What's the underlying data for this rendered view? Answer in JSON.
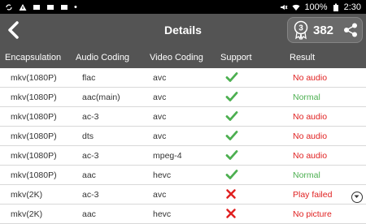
{
  "status_bar": {
    "battery": "100%",
    "time": "2:30"
  },
  "header": {
    "title": "Details",
    "score_badge_digit": "3",
    "score": "382"
  },
  "table": {
    "headers": [
      "Encapsulation",
      "Audio Coding",
      "Video Coding",
      "Support",
      "Result"
    ],
    "rows": [
      {
        "encapsulation": "mkv(1080P)",
        "audio": "flac",
        "video": "avc",
        "support": "check",
        "result": "No audio",
        "result_color": "#e02020"
      },
      {
        "encapsulation": "mkv(1080P)",
        "audio": "aac(main)",
        "video": "avc",
        "support": "check",
        "result": "Normal",
        "result_color": "#4caf50"
      },
      {
        "encapsulation": "mkv(1080P)",
        "audio": "ac-3",
        "video": "avc",
        "support": "check",
        "result": "No audio",
        "result_color": "#e02020"
      },
      {
        "encapsulation": "mkv(1080P)",
        "audio": "dts",
        "video": "avc",
        "support": "check",
        "result": "No audio",
        "result_color": "#e02020"
      },
      {
        "encapsulation": "mkv(1080P)",
        "audio": "ac-3",
        "video": "mpeg-4",
        "support": "check",
        "result": "No audio",
        "result_color": "#e02020"
      },
      {
        "encapsulation": "mkv(1080P)",
        "audio": "aac",
        "video": "hevc",
        "support": "check",
        "result": "Normal",
        "result_color": "#4caf50"
      },
      {
        "encapsulation": "mkv(2K)",
        "audio": "ac-3",
        "video": "avc",
        "support": "cross",
        "result": "Play failed",
        "result_color": "#e02020"
      },
      {
        "encapsulation": "mkv(2K)",
        "audio": "aac",
        "video": "hevc",
        "support": "cross",
        "result": "No picture",
        "result_color": "#e02020"
      }
    ]
  },
  "colors": {
    "header_bg": "#545454",
    "check": "#4caf50",
    "cross": "#e02020"
  }
}
